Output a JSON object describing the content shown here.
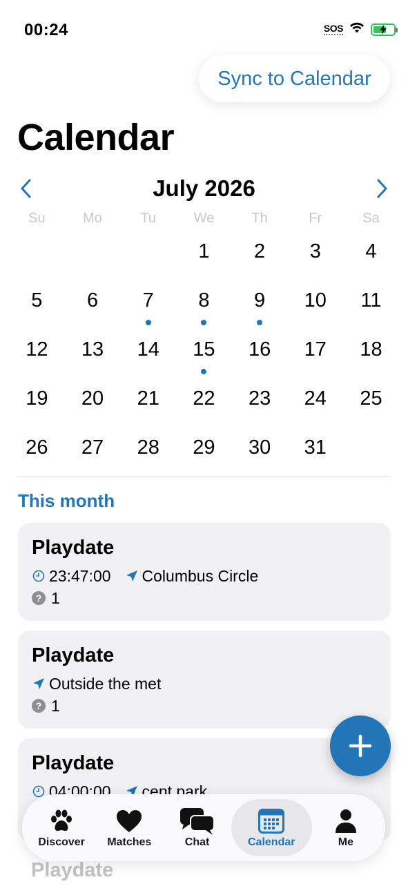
{
  "status_bar": {
    "time": "00:24",
    "sos": "SOS"
  },
  "sync_button": {
    "label": "Sync to Calendar"
  },
  "page_title": "Calendar",
  "calendar": {
    "month_label": "July 2026",
    "weekdays": [
      "Su",
      "Mo",
      "Tu",
      "We",
      "Th",
      "Fr",
      "Sa"
    ],
    "leading_blanks": 3,
    "days": [
      "1",
      "2",
      "3",
      "4",
      "5",
      "6",
      "7",
      "8",
      "9",
      "10",
      "11",
      "12",
      "13",
      "14",
      "15",
      "16",
      "17",
      "18",
      "19",
      "20",
      "21",
      "22",
      "23",
      "24",
      "25",
      "26",
      "27",
      "28",
      "29",
      "30",
      "31"
    ],
    "event_days": [
      7,
      8,
      9,
      15
    ]
  },
  "section_title": "This month",
  "events": [
    {
      "title": "Playdate",
      "time": "23:47:00",
      "location": "Columbus Circle",
      "count": "1"
    },
    {
      "title": "Playdate",
      "time": "",
      "location": "Outside the met",
      "count": "1"
    },
    {
      "title": "Playdate",
      "time": "04:00:00",
      "location": "cent park",
      "count": ""
    },
    {
      "title": "Playdate"
    }
  ],
  "tabs": [
    {
      "label": "Discover",
      "icon": "paw-icon",
      "active": false
    },
    {
      "label": "Matches",
      "icon": "heart-icon",
      "active": false
    },
    {
      "label": "Chat",
      "icon": "chat-bubbles-icon",
      "active": false
    },
    {
      "label": "Calendar",
      "icon": "calendar-icon",
      "active": true
    },
    {
      "label": "Me",
      "icon": "person-icon",
      "active": false
    }
  ],
  "colors": {
    "accent": "#2276b7",
    "card_bg": "#f1f1f4",
    "weekday": "#c8c8cc",
    "battery": "#34c759"
  }
}
